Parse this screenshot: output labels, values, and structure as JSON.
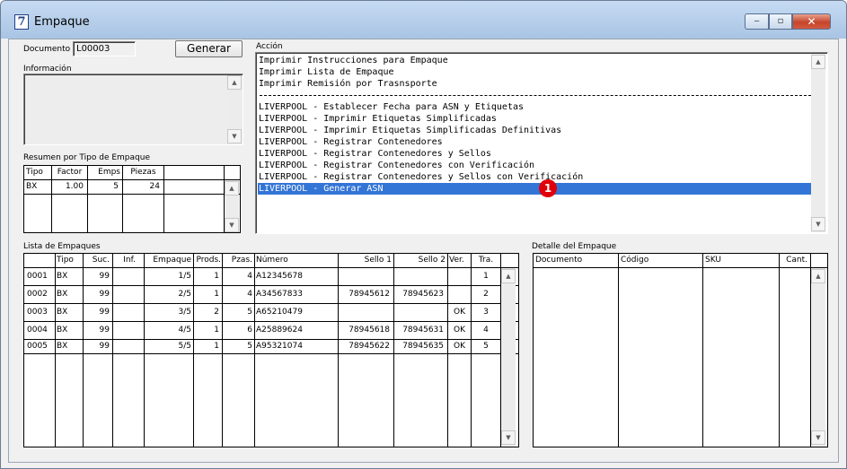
{
  "window": {
    "title": "Empaque",
    "minimize": "‒",
    "maximize": "▫",
    "close": "✕",
    "app_icon": "7"
  },
  "documento": {
    "label": "Documento :",
    "value": "L00003"
  },
  "generar_button": "Generar",
  "informacion": {
    "label": "Información",
    "value": ""
  },
  "accion": {
    "label": "Acción",
    "items_top": [
      "Imprimir Instrucciones para Empaque",
      "Imprimir Lista de Empaque",
      "Imprimir Remisión por Trasnsporte"
    ],
    "items_bottom": [
      "LIVERPOOL - Establecer Fecha para ASN y Etiquetas",
      "LIVERPOOL - Imprimir Etiquetas Simplificadas",
      "LIVERPOOL - Imprimir Etiquetas Simplificadas Definitivas",
      "LIVERPOOL - Registrar Contenedores",
      "LIVERPOOL - Registrar Contenedores y Sellos",
      "LIVERPOOL - Registrar Contenedores con Verificación",
      "LIVERPOOL - Registrar Contenedores y Sellos con Verificación",
      "LIVERPOOL - Generar ASN"
    ],
    "selected_item": "LIVERPOOL - Generar ASN"
  },
  "annotation_badge": "1",
  "resumen": {
    "label": "Resumen por Tipo de Empaque",
    "columns": [
      "Tipo",
      "Factor",
      "Emps",
      "Piezas",
      ""
    ],
    "rows": [
      [
        "BX",
        "1.00",
        "5",
        "24",
        ""
      ]
    ]
  },
  "lista": {
    "label": "Lista de Empaques",
    "columns": [
      "",
      "Tipo",
      "Suc.",
      "Inf.",
      "Empaque",
      "Prods.",
      "Pzas.",
      "Número",
      "Sello 1",
      "Sello 2",
      "Ver.",
      "Tra."
    ],
    "rows": [
      [
        "0001",
        "BX",
        "99",
        "",
        "1/5",
        "1",
        "4",
        "A12345678",
        "",
        "",
        "",
        "1"
      ],
      [
        "0002",
        "BX",
        "99",
        "",
        "2/5",
        "1",
        "4",
        "A34567833",
        "78945612",
        "78945623",
        "",
        "2"
      ],
      [
        "0003",
        "BX",
        "99",
        "",
        "3/5",
        "2",
        "5",
        "A65210479",
        "",
        "",
        "OK",
        "3"
      ],
      [
        "0004",
        "BX",
        "99",
        "",
        "4/5",
        "1",
        "6",
        "A25889624",
        "78945618",
        "78945631",
        "OK",
        "4"
      ],
      [
        "0005",
        "BX",
        "99",
        "",
        "5/5",
        "1",
        "5",
        "A95321074",
        "78945622",
        "78945635",
        "OK",
        "5"
      ]
    ]
  },
  "detalle": {
    "label": "Detalle del Empaque",
    "columns": [
      "Documento",
      "Código",
      "SKU",
      "Cant."
    ],
    "rows": []
  },
  "scroll_up": "▲",
  "scroll_down": "▼",
  "colors": {
    "selection": "#3375d6",
    "badge": "#e0000a",
    "titlebar": "#b4cde9"
  }
}
